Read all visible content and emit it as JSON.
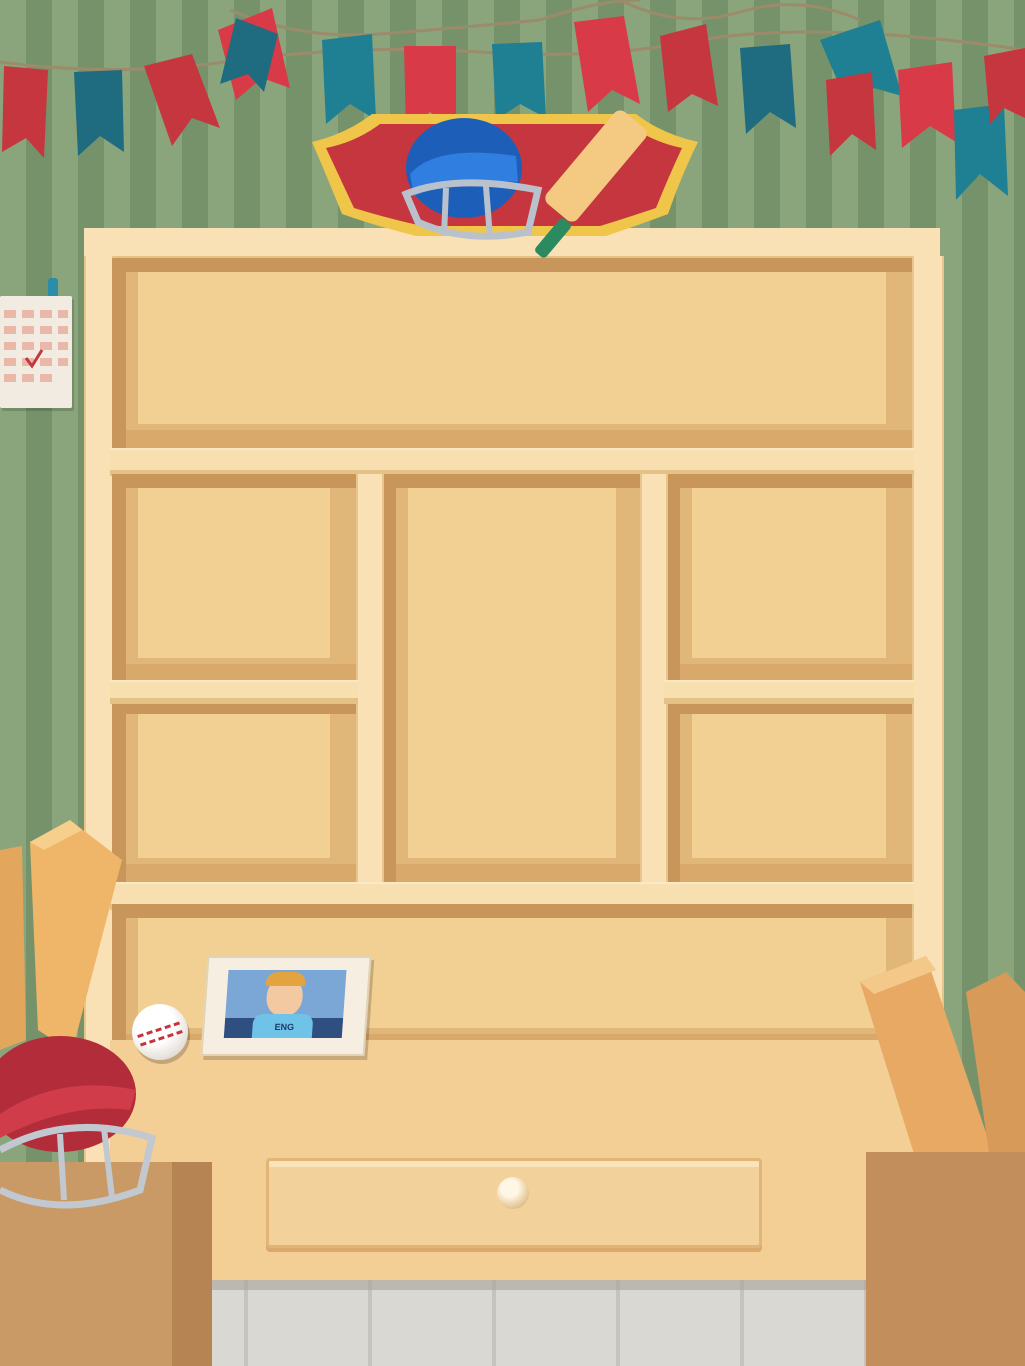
{
  "scene": {
    "type": "empty trophy cabinet",
    "colors": {
      "wall_light": "#8aa57b",
      "wall_dark": "#76926a",
      "wood": "#f6d9a6",
      "bunting_red": "#d83a48",
      "bunting_teal": "#1f7f93",
      "badge_red": "#c5363f",
      "badge_gold": "#f0c64a"
    }
  },
  "photo_card": {
    "jersey_text": "ENG"
  },
  "icons": {
    "badge": "cricket-helmet-and-bat-icon",
    "ball": "cricket-ball-icon",
    "helmet": "cricket-helmet-icon",
    "bat": "cricket-bat-icon"
  }
}
